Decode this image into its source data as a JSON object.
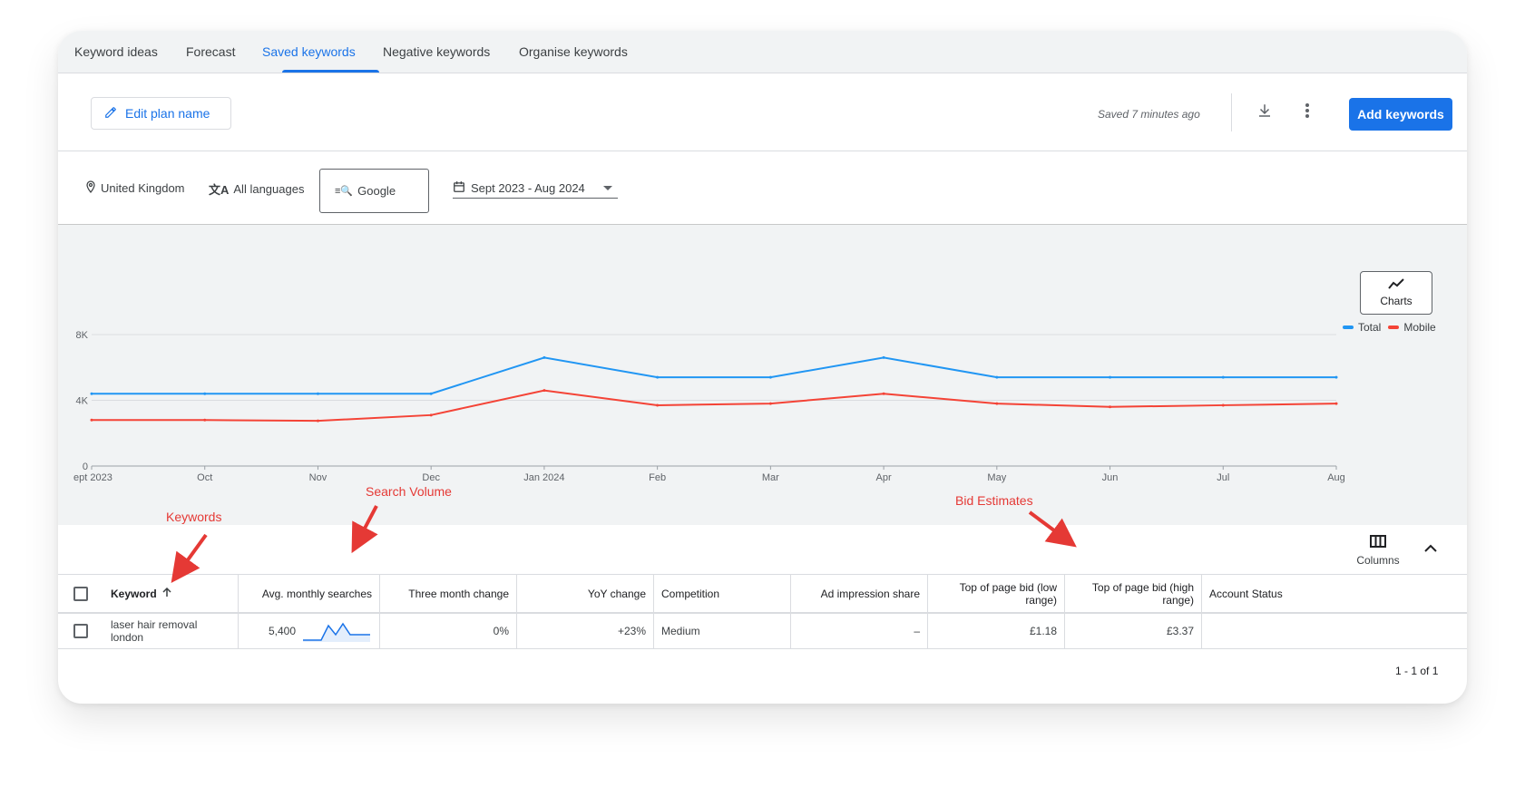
{
  "tabs": [
    {
      "label": "Keyword ideas"
    },
    {
      "label": "Forecast"
    },
    {
      "label": "Saved keywords",
      "active": true
    },
    {
      "label": "Negative keywords"
    },
    {
      "label": "Organise keywords"
    }
  ],
  "toolbar": {
    "edit_label": "Edit plan name",
    "saved_text": "Saved 7 minutes ago",
    "add_keywords_label": "Add keywords"
  },
  "filters": {
    "location": "United Kingdom",
    "language": "All languages",
    "network": "Google",
    "date_range": "Sept 2023 - Aug 2024"
  },
  "chart_controls": {
    "charts_label": "Charts",
    "legend": [
      {
        "name": "Total",
        "color": "#2196f3"
      },
      {
        "name": "Mobile",
        "color": "#f44336"
      }
    ]
  },
  "chart_data": {
    "type": "line",
    "categories": [
      "ept 2023",
      "Oct",
      "Nov",
      "Dec",
      "Jan 2024",
      "Feb",
      "Mar",
      "Apr",
      "May",
      "Jun",
      "Jul",
      "Aug"
    ],
    "y_ticks": [
      "0",
      "4K",
      "8K"
    ],
    "ylim": [
      0,
      8000
    ],
    "series": [
      {
        "name": "Total",
        "color": "#2196f3",
        "values": [
          4400,
          4400,
          4400,
          4400,
          6600,
          5400,
          5400,
          6600,
          5400,
          5400,
          5400,
          5400
        ]
      },
      {
        "name": "Mobile",
        "color": "#f44336",
        "values": [
          2800,
          2800,
          2750,
          3100,
          4600,
          3700,
          3800,
          4400,
          3800,
          3600,
          3700,
          3800
        ]
      }
    ],
    "grid": true,
    "legend_position": "top-right"
  },
  "table": {
    "columns_label": "Columns",
    "headers": {
      "keyword": "Keyword",
      "avg_searches": "Avg. monthly searches",
      "three_month": "Three month change",
      "yoy": "YoY change",
      "competition": "Competition",
      "ad_share": "Ad impression share",
      "bid_low": "Top of page bid (low range)",
      "bid_high": "Top of page bid (high range)",
      "account_status": "Account Status"
    },
    "rows": [
      {
        "keyword": "laser hair removal london",
        "avg_searches": "5,400",
        "three_month": "0%",
        "yoy": "+23%",
        "competition": "Medium",
        "ad_share": "–",
        "bid_low": "£1.18",
        "bid_high": "£3.37",
        "account_status": ""
      }
    ],
    "pagination": "1 - 1 of 1"
  },
  "annotations": {
    "keywords": "Keywords",
    "search_volume": "Search Volume",
    "bid_estimates": "Bid Estimates"
  }
}
